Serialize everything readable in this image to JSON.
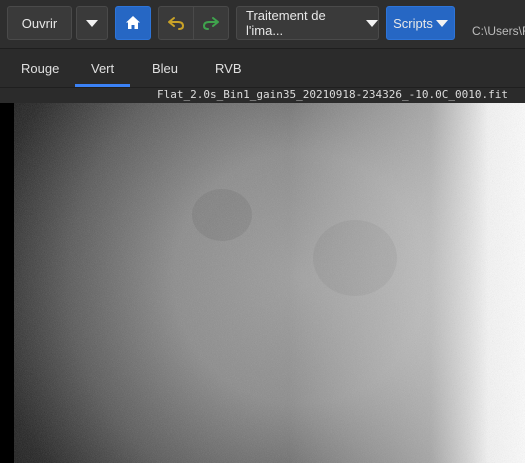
{
  "toolbar": {
    "open_label": "Ouvrir",
    "processing_label": "Traitement de l'ima...",
    "scripts_label": "Scripts",
    "path_text": "C:\\Users\\F"
  },
  "tabs": [
    {
      "label": "Rouge",
      "active": false
    },
    {
      "label": "Vert",
      "active": true
    },
    {
      "label": "Bleu",
      "active": false
    },
    {
      "label": "RVB",
      "active": false
    }
  ],
  "viewer": {
    "filename": "Flat_2.0s_Bin1_gain35_20210918-234326_-10.0C_0010.fit"
  },
  "icons": {
    "dropdown": "chevron-down-icon",
    "home": "home-icon",
    "undo": "undo-icon",
    "redo": "redo-icon"
  },
  "colors": {
    "accent": "#2667c4",
    "tab_indicator": "#3b82f6",
    "undo": "#c9a227",
    "redo": "#3fa34d"
  }
}
